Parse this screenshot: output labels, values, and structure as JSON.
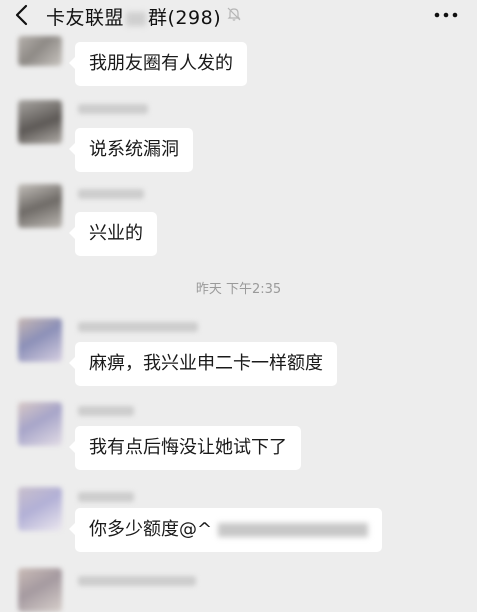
{
  "header": {
    "back_icon": "chevron-left-icon",
    "title_prefix": "卡友联盟",
    "title_suffix": "群(298)",
    "mute_icon": "bell-muted-icon",
    "more_icon": "more-dots-icon"
  },
  "messages": [
    {
      "text": "我朋友圈有人发的"
    },
    {
      "text": "说系统漏洞"
    },
    {
      "text": "兴业的"
    },
    {
      "text": "麻痹，我兴业申二卡一样额度"
    },
    {
      "text": "我有点后悔没让她试下了"
    },
    {
      "text": "你多少额度@^"
    }
  ],
  "timestamp": "昨天 下午2:35",
  "colors": {
    "background": "#ededed",
    "bubble": "#ffffff",
    "text": "#1a1a1a",
    "timestamp": "#9a9a9a"
  }
}
